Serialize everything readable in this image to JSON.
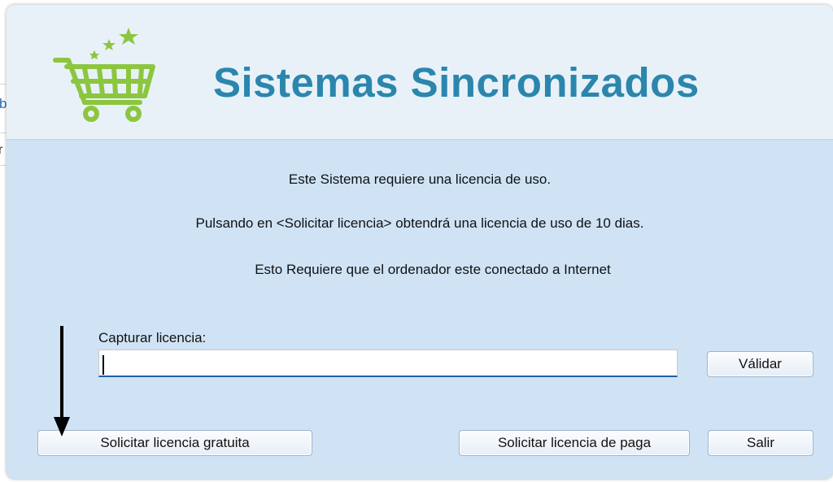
{
  "background": {
    "char_a": "b",
    "char_b": "r"
  },
  "header": {
    "title": "Sistemas Sincronizados",
    "logo_icon": "shopping-cart-with-stars",
    "title_color": "#2b86ad",
    "logo_color": "#8cc63f"
  },
  "messages": {
    "line1": "Este Sistema requiere una licencia de uso.",
    "line2": "Pulsando en <Solicitar licencia> obtendrá una licencia de uso de 10 dias.",
    "line3": "Esto Requiere que el ordenador este conectado a Internet"
  },
  "license": {
    "label": "Capturar licencia:",
    "value": "",
    "validate_label": "Válidar"
  },
  "buttons": {
    "free_license": "Solicitar licencia gratuita",
    "paid_license": "Solicitar licencia de paga",
    "exit": "Salir"
  },
  "colors": {
    "body_bg": "#cfe3f5",
    "header_bg": "#e8f1f8",
    "input_underline": "#1f5fa8"
  }
}
